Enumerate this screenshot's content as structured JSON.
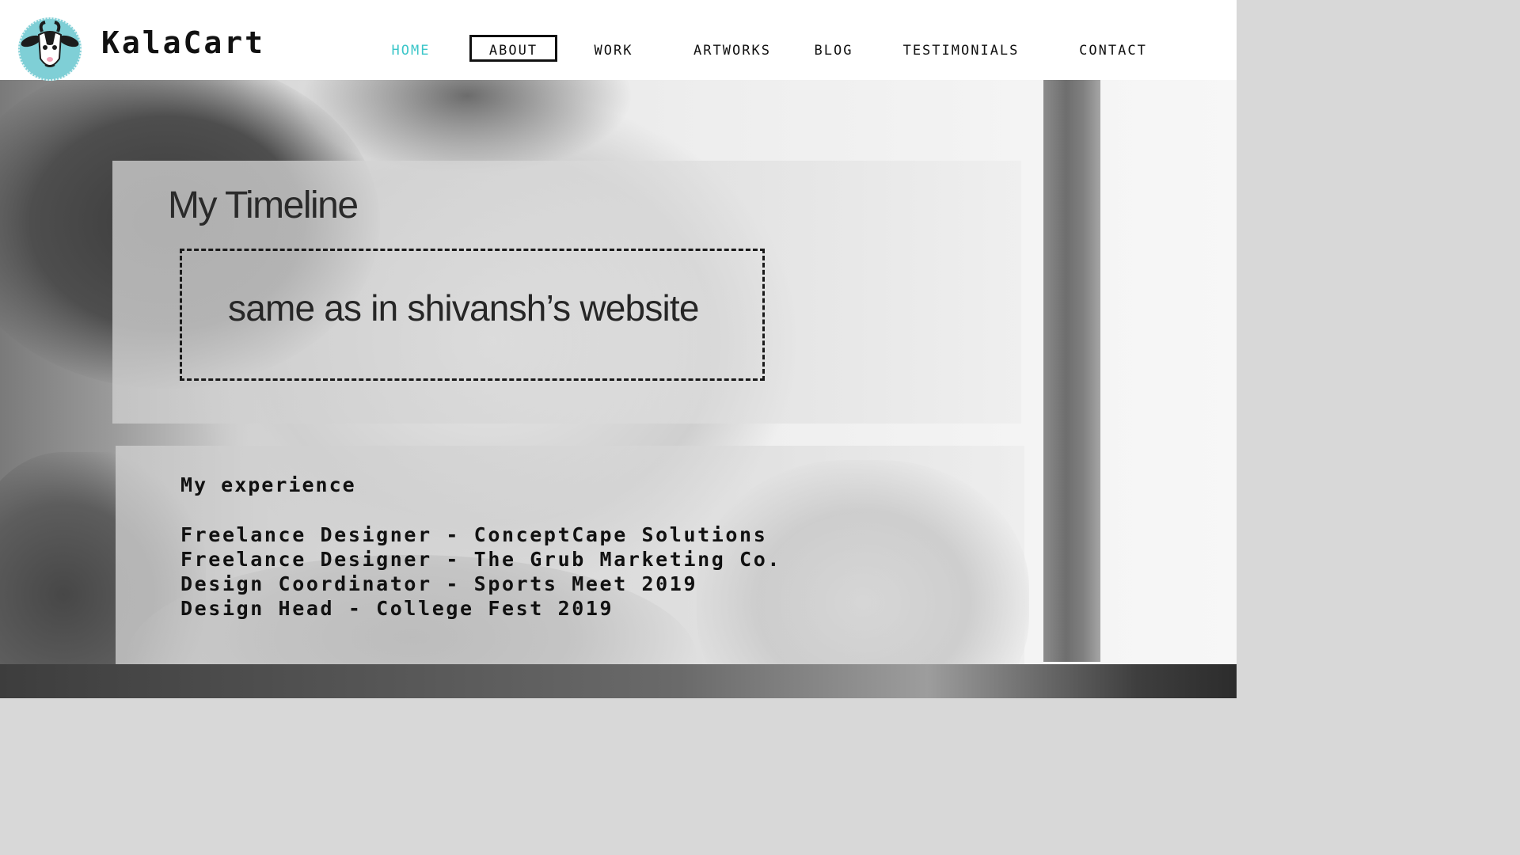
{
  "brand": {
    "name": "KalaCart",
    "logo_icon": "goat-icon"
  },
  "nav": {
    "items": [
      {
        "label": "HOME",
        "state": "active"
      },
      {
        "label": "ABOUT",
        "state": "boxed"
      },
      {
        "label": "WORK",
        "state": "normal"
      },
      {
        "label": "ARTWORKS",
        "state": "normal"
      },
      {
        "label": "BLOG",
        "state": "normal"
      },
      {
        "label": "TESTIMONIALS",
        "state": "normal"
      },
      {
        "label": "CONTACT",
        "state": "normal"
      }
    ]
  },
  "timeline": {
    "title": "My Timeline",
    "placeholder_note": "same as in shivansh’s website"
  },
  "experience": {
    "heading": "My experience",
    "items": [
      "Freelance Designer - ConceptCape Solutions",
      "Freelance Designer - The Grub Marketing Co.",
      "Design Coordinator - Sports Meet 2019",
      "Design Head - College Fest 2019"
    ]
  },
  "colors": {
    "accent": "#3cc6c9",
    "logo_bg": "#7fcfd6",
    "text": "#111111",
    "header_bg": "#ffffff"
  }
}
